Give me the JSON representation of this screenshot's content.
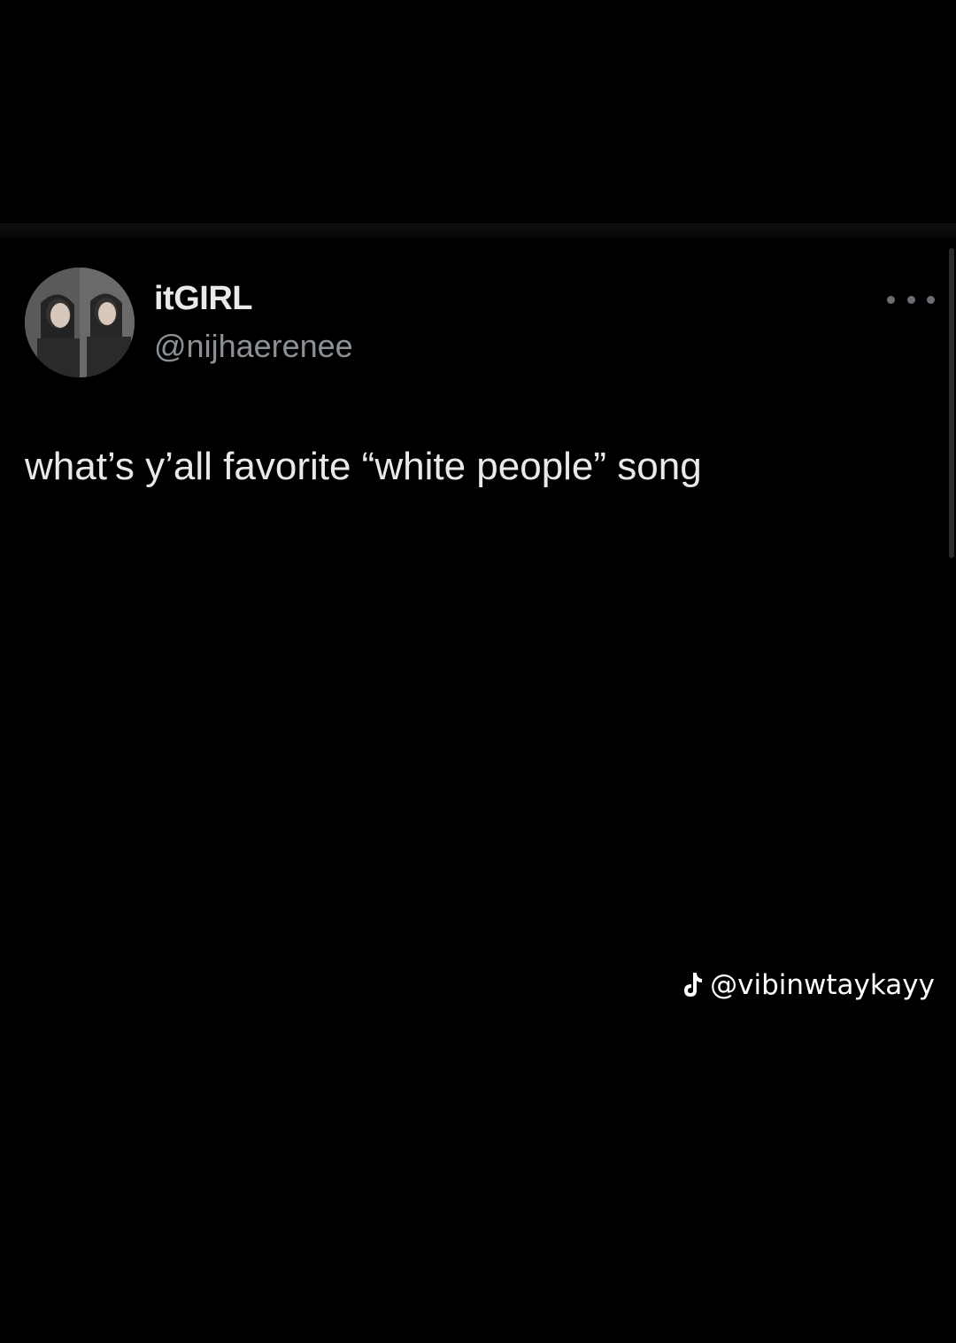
{
  "tweet": {
    "display_name": "itGIRL",
    "handle": "@nijhaerenee",
    "text": "what’s y’all favorite “white people” song",
    "more_icon": "more-horizontal-icon"
  },
  "watermark": {
    "icon": "tiktok-icon",
    "username": "@vibinwtaykayy"
  },
  "colors": {
    "background": "#000000",
    "primary_text": "#e7e9ea",
    "secondary_text": "#8b9196"
  }
}
